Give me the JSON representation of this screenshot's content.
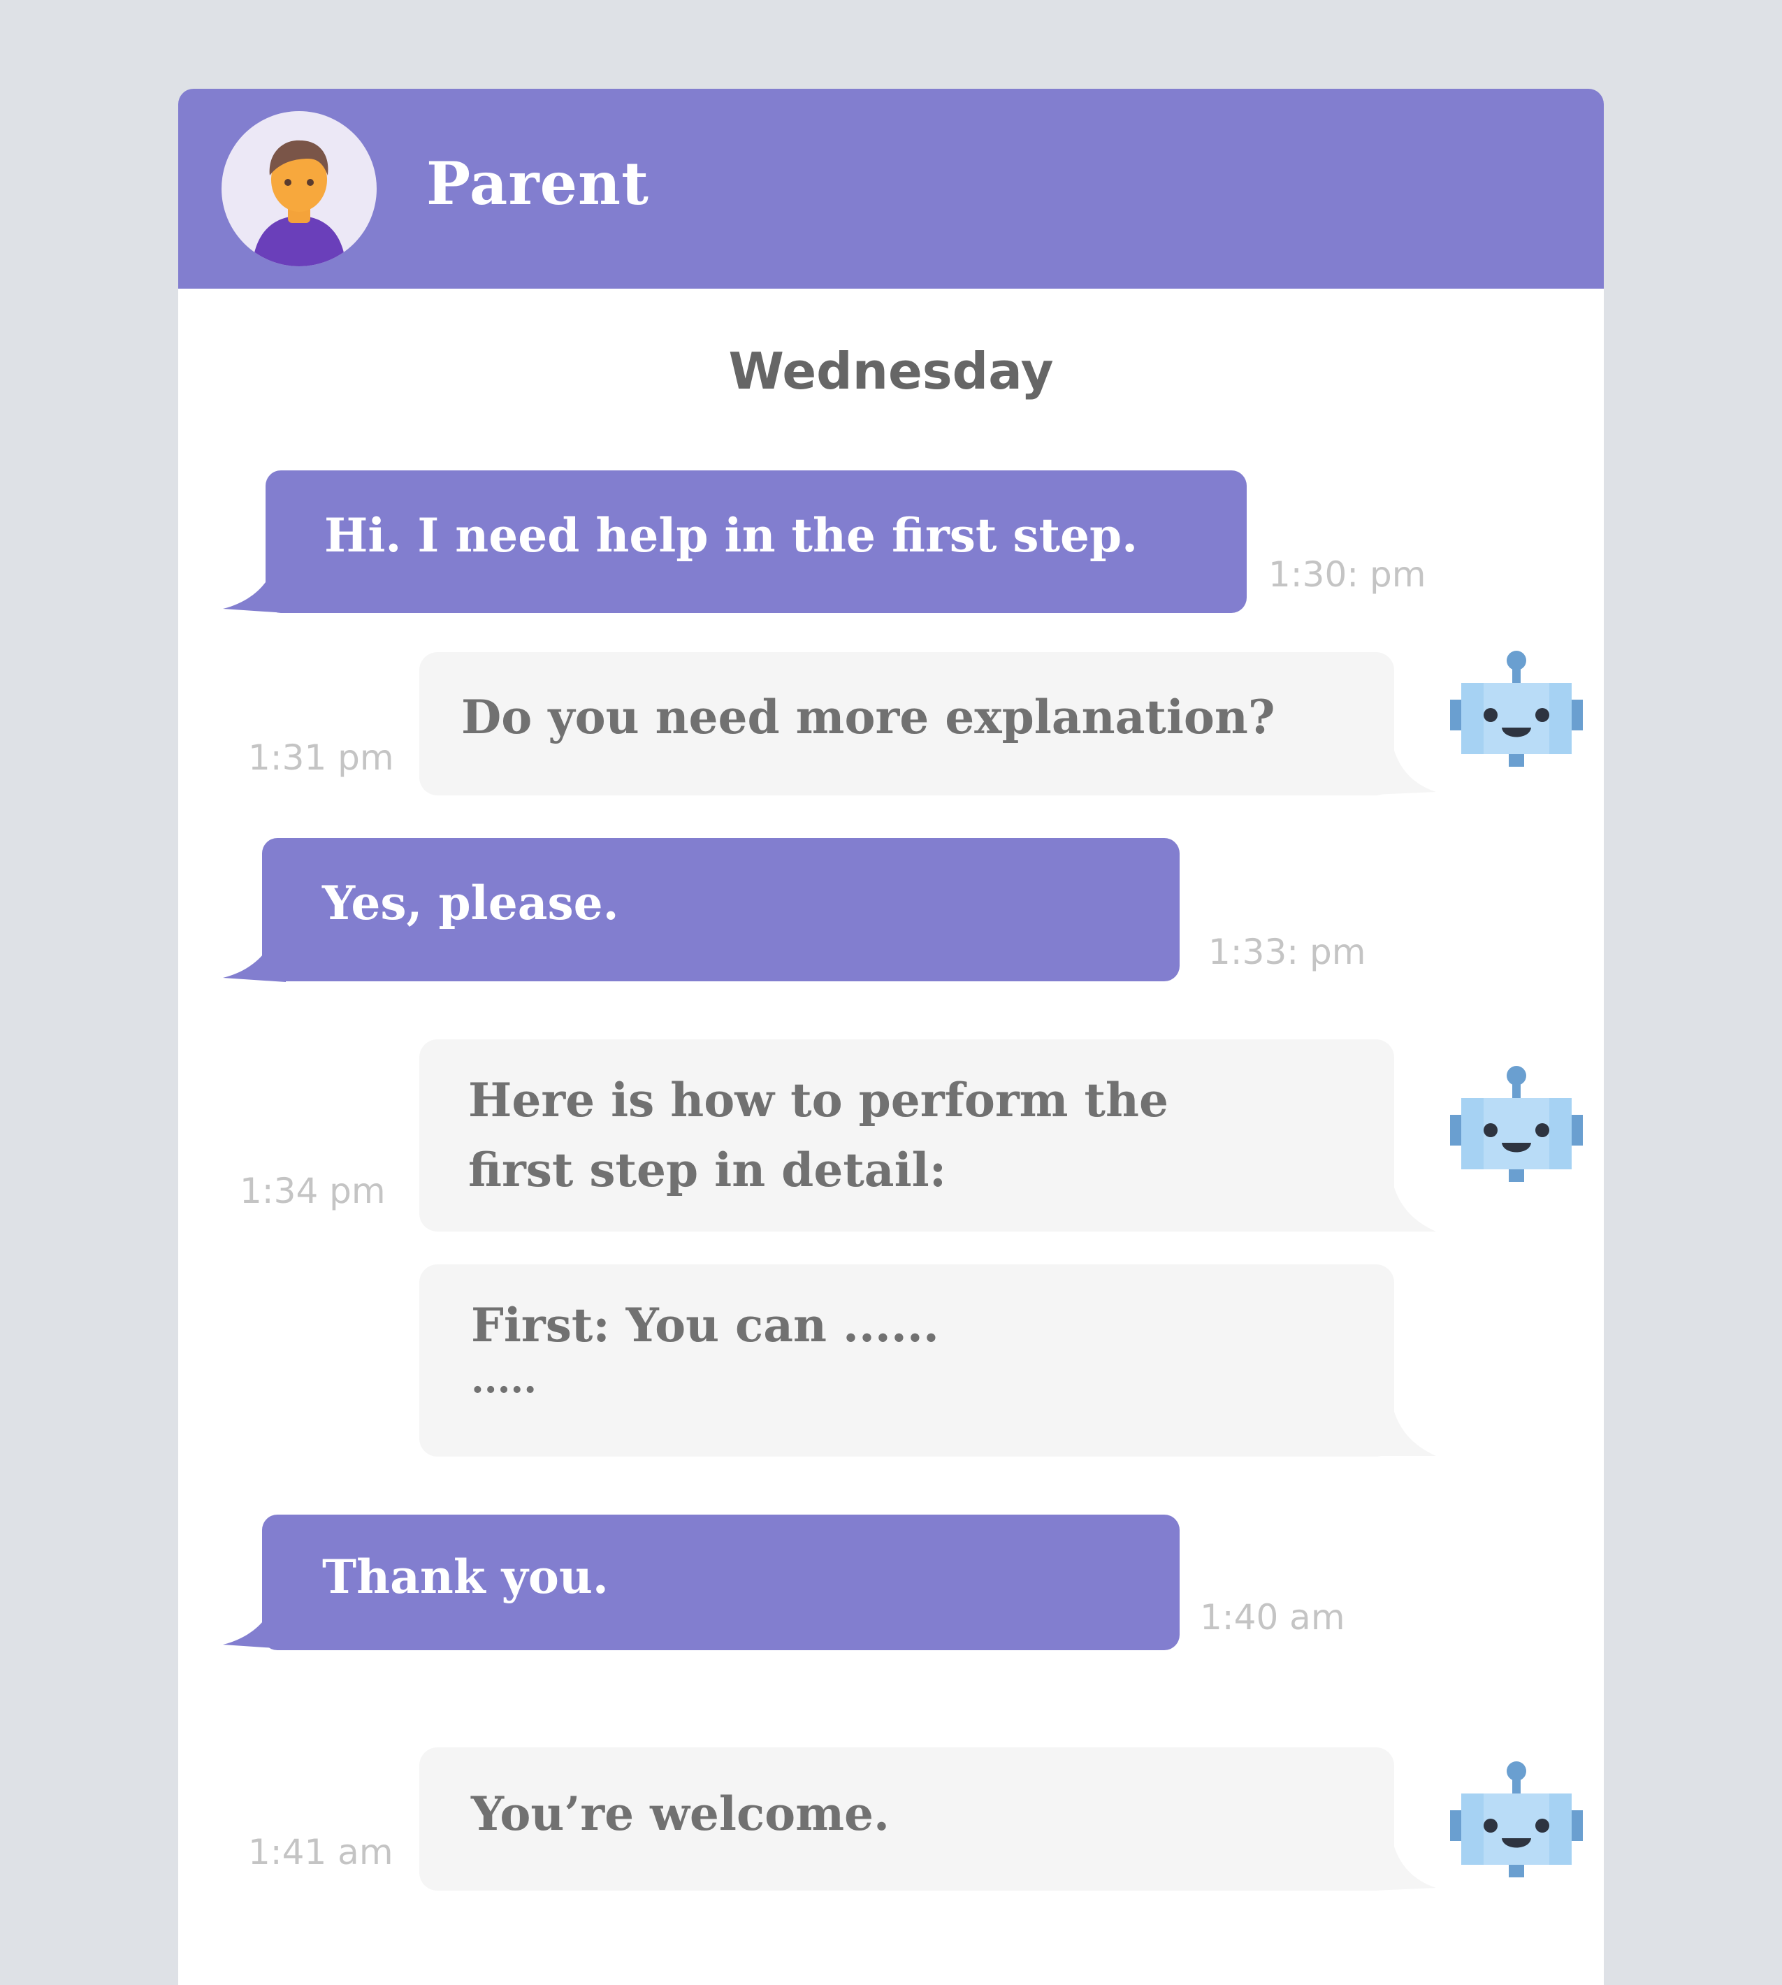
{
  "header": {
    "contact_name": "Parent",
    "avatar_icon": "person-avatar-icon"
  },
  "day_label": "Wednesday",
  "colors": {
    "accent": "#827ecf",
    "bot_bubble": "#f5f5f5",
    "background": "#dee1e6",
    "timestamp": "#c4c4c4"
  },
  "messages": [
    {
      "sender": "user",
      "text": "Hi. I need help in the first step.",
      "time": "1:30: pm"
    },
    {
      "sender": "bot",
      "text": "Do you need more explanation?",
      "time": "1:31 pm",
      "icon": "robot-icon"
    },
    {
      "sender": "user",
      "text": "Yes, please.",
      "time": "1:33: pm"
    },
    {
      "sender": "bot",
      "lines": [
        "Here is how to perform the",
        "first step in detail:"
      ],
      "time": "1:34 pm",
      "icon": "robot-icon"
    },
    {
      "sender": "bot",
      "lines": [
        "First: You can ......",
        "....."
      ]
    },
    {
      "sender": "user",
      "text": "Thank you.",
      "time": "1:40 am"
    },
    {
      "sender": "bot",
      "text": "You’re welcome.",
      "time": "1:41 am",
      "icon": "robot-icon"
    }
  ]
}
